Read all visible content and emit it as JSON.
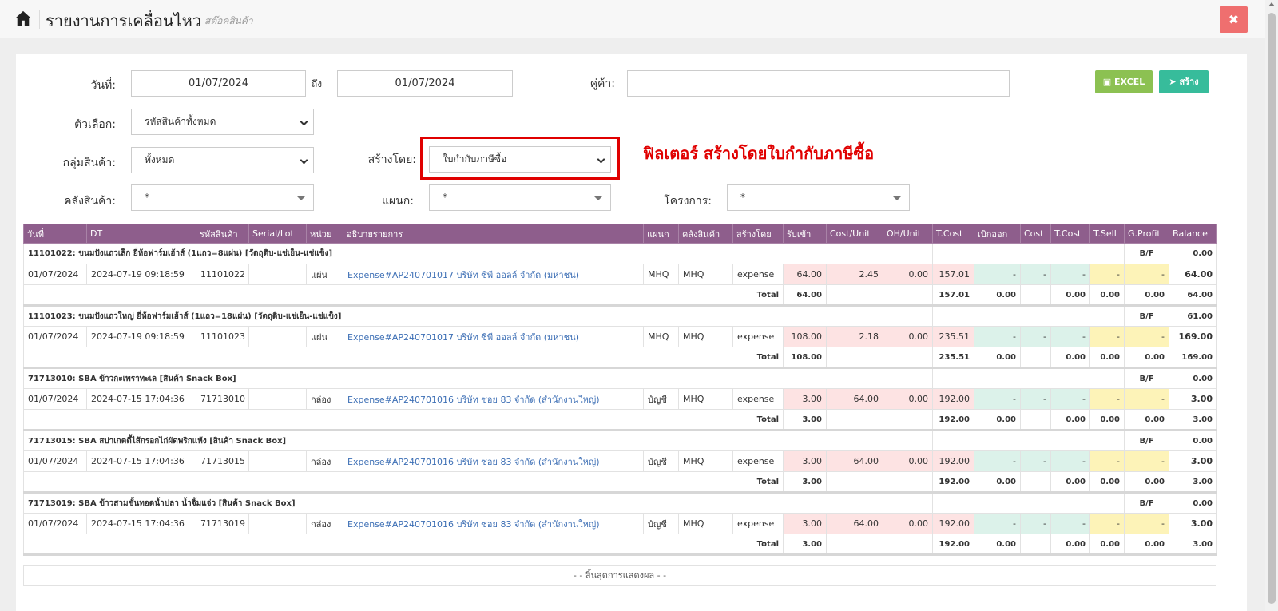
{
  "header": {
    "title": "รายงานการเคลื่อนไหว",
    "subtitle": "สต๊อคสินค้า",
    "close_label": "✖"
  },
  "filters": {
    "date_label": "วันที่:",
    "date_from": "01/07/2024",
    "to_label": "ถึง",
    "date_to": "01/07/2024",
    "partner_label": "คู่ค้า:",
    "partner_value": "",
    "option_label": "ตัวเลือก:",
    "option_value": "รหัสสินค้าทั้งหมด",
    "group_label": "กลุ่มสินค้า:",
    "group_value": "ทั้งหมด",
    "created_by_label": "สร้างโดย:",
    "created_by_value": "ใบกำกับภาษีซื้อ",
    "warehouse_label": "คลังสินค้า:",
    "warehouse_value": "*",
    "department_label": "แผนก:",
    "department_value": "*",
    "project_label": "โครงการ:",
    "project_value": "*"
  },
  "buttons": {
    "excel": "EXCEL",
    "create": "สร้าง"
  },
  "annotation": "ฟิลเตอร์ สร้างโดยใบกำกับภาษีซื้อ",
  "table": {
    "columns": [
      "วันที่",
      "DT",
      "รหัสสินค้า",
      "Serial/Lot",
      "หน่วย",
      "อธิบายรายการ",
      "แผนก",
      "คลังสินค้า",
      "สร้างโดย",
      "รับเข้า",
      "Cost/Unit",
      "OH/Unit",
      "T.Cost",
      "เบิกออก",
      "Cost",
      "T.Cost",
      "T.Sell",
      "G.Profit",
      "Balance"
    ],
    "bf_label": "B/F",
    "total_label": "Total",
    "groups": [
      {
        "title": "11101022: ขนมปังแถวเล็ก ยี่ห้อฟาร์มเฮ้าส์ (1แถว=8แผ่น) [วัตถุดิบ-แช่เย็น-แช่แข็ง]",
        "bf_balance": "0.00",
        "row": {
          "date": "01/07/2024",
          "dt": "2024-07-19 09:18:59",
          "code": "11101022",
          "serial": "",
          "unit": "แผ่น",
          "desc": "Expense#AP240701017 บริษัท ซีพี ออลล์ จำกัด (มหาชน)",
          "dept": "MHQ",
          "wh": "MHQ",
          "by": "expense",
          "in": "64.00",
          "cpu": "2.45",
          "ohu": "0.00",
          "tcost": "157.01",
          "out": "-",
          "cost": "-",
          "tcost2": "-",
          "tsell": "-",
          "gp": "-",
          "bal": "64.00"
        },
        "total": {
          "in": "64.00",
          "tcost": "157.01",
          "out": "0.00",
          "tcost2": "0.00",
          "tsell": "0.00",
          "gp": "0.00",
          "bal": "64.00"
        }
      },
      {
        "title": "11101023: ขนมปังแถวใหญ่ ยี่ห้อฟาร์มเฮ้าส์ (1แถว=18แผ่น) [วัตถุดิบ-แช่เย็น-แช่แข็ง]",
        "bf_balance": "61.00",
        "row": {
          "date": "01/07/2024",
          "dt": "2024-07-19 09:18:59",
          "code": "11101023",
          "serial": "",
          "unit": "แผ่น",
          "desc": "Expense#AP240701017 บริษัท ซีพี ออลล์ จำกัด (มหาชน)",
          "dept": "MHQ",
          "wh": "MHQ",
          "by": "expense",
          "in": "108.00",
          "cpu": "2.18",
          "ohu": "0.00",
          "tcost": "235.51",
          "out": "-",
          "cost": "-",
          "tcost2": "-",
          "tsell": "-",
          "gp": "-",
          "bal": "169.00"
        },
        "total": {
          "in": "108.00",
          "tcost": "235.51",
          "out": "0.00",
          "tcost2": "0.00",
          "tsell": "0.00",
          "gp": "0.00",
          "bal": "169.00"
        }
      },
      {
        "title": "71713010: SBA ข้าวกะเพราทะเล [สินค้า Snack Box]",
        "bf_balance": "0.00",
        "row": {
          "date": "01/07/2024",
          "dt": "2024-07-15 17:04:36",
          "code": "71713010",
          "serial": "",
          "unit": "กล่อง",
          "desc": "Expense#AP240701016 บริษัท ซอย 83 จำกัด (สำนักงานใหญ่)",
          "dept": "บัญชี",
          "wh": "MHQ",
          "by": "expense",
          "in": "3.00",
          "cpu": "64.00",
          "ohu": "0.00",
          "tcost": "192.00",
          "out": "-",
          "cost": "-",
          "tcost2": "-",
          "tsell": "-",
          "gp": "-",
          "bal": "3.00"
        },
        "total": {
          "in": "3.00",
          "tcost": "192.00",
          "out": "0.00",
          "tcost2": "0.00",
          "tsell": "0.00",
          "gp": "0.00",
          "bal": "3.00"
        }
      },
      {
        "title": "71713015: SBA สปาเกตตี้ไส้กรอกไก่ผัดพริกแห้ง [สินค้า Snack Box]",
        "bf_balance": "0.00",
        "row": {
          "date": "01/07/2024",
          "dt": "2024-07-15 17:04:36",
          "code": "71713015",
          "serial": "",
          "unit": "กล่อง",
          "desc": "Expense#AP240701016 บริษัท ซอย 83 จำกัด (สำนักงานใหญ่)",
          "dept": "บัญชี",
          "wh": "MHQ",
          "by": "expense",
          "in": "3.00",
          "cpu": "64.00",
          "ohu": "0.00",
          "tcost": "192.00",
          "out": "-",
          "cost": "-",
          "tcost2": "-",
          "tsell": "-",
          "gp": "-",
          "bal": "3.00"
        },
        "total": {
          "in": "3.00",
          "tcost": "192.00",
          "out": "0.00",
          "tcost2": "0.00",
          "tsell": "0.00",
          "gp": "0.00",
          "bal": "3.00"
        }
      },
      {
        "title": "71713019: SBA ข้าวสามชั้นทอดน้ำปลา น้ำจิ้มแจ่ว [สินค้า Snack Box]",
        "bf_balance": "0.00",
        "row": {
          "date": "01/07/2024",
          "dt": "2024-07-15 17:04:36",
          "code": "71713019",
          "serial": "",
          "unit": "กล่อง",
          "desc": "Expense#AP240701016 บริษัท ซอย 83 จำกัด (สำนักงานใหญ่)",
          "dept": "บัญชี",
          "wh": "MHQ",
          "by": "expense",
          "in": "3.00",
          "cpu": "64.00",
          "ohu": "0.00",
          "tcost": "192.00",
          "out": "-",
          "cost": "-",
          "tcost2": "-",
          "tsell": "-",
          "gp": "-",
          "bal": "3.00"
        },
        "total": {
          "in": "3.00",
          "tcost": "192.00",
          "out": "0.00",
          "tcost2": "0.00",
          "tsell": "0.00",
          "gp": "0.00",
          "bal": "3.00"
        }
      }
    ],
    "end_text": "- - สิ้นสุดการแสดงผล - -"
  },
  "colors": {
    "header_bg": "#8e5e8c",
    "in_bg": "#fde3e3",
    "out_bg": "#dcf2ea",
    "sell_bg": "#fdf3b8",
    "annotation": "#e00000",
    "excel_btn": "#8cc152",
    "create_btn": "#37bc9b",
    "close_btn": "#ef6f6f"
  },
  "icons": [
    "home-icon",
    "close-icon",
    "excel-icon",
    "send-icon",
    "chevron-down-icon",
    "caret-down-icon"
  ]
}
